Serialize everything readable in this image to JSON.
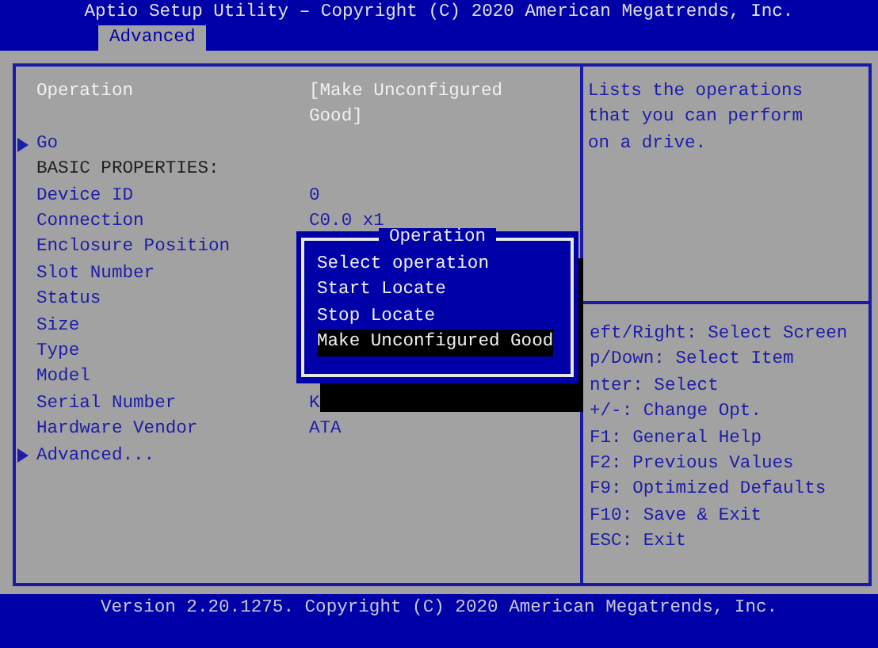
{
  "header": {
    "title": "Aptio Setup Utility – Copyright (C) 2020 American Megatrends, Inc.",
    "tabs": [
      {
        "label": "Advanced",
        "selected": true
      }
    ]
  },
  "items": [
    {
      "kind": "setting",
      "label": "Operation",
      "value": "[Make Unconfigured Good]",
      "focused": true
    },
    {
      "kind": "submenu",
      "label": "Go",
      "focused": false
    },
    {
      "kind": "header",
      "label": "BASIC PROPERTIES:"
    },
    {
      "kind": "setting",
      "label": "Device ID",
      "value": "0",
      "focused": false
    },
    {
      "kind": "setting",
      "label": "Connection",
      "value": "C0.0 x1",
      "focused": false
    },
    {
      "kind": "setting",
      "label": "Enclosure Position",
      "focused": false
    },
    {
      "kind": "setting",
      "label": "Slot Number",
      "focused": false
    },
    {
      "kind": "setting",
      "label": "Status",
      "focused": false
    },
    {
      "kind": "setting",
      "label": "Size",
      "focused": false
    },
    {
      "kind": "setting",
      "label": "Type",
      "focused": false
    },
    {
      "kind": "setting",
      "label": "Model",
      "focused": false
    },
    {
      "kind": "setting",
      "label": "Serial Number",
      "value": "K",
      "focused": false
    },
    {
      "kind": "setting",
      "label": "Hardware Vendor",
      "value": "ATA",
      "focused": false
    },
    {
      "kind": "submenu",
      "label": "Advanced...",
      "focused": false
    }
  ],
  "help": "Lists the operations that you can perform on a drive.",
  "keys": [
    "eft/Right: Select Screen",
    "p/Down: Select Item",
    "nter: Select",
    "+/-: Change Opt.",
    "F1: General Help",
    "F2: Previous Values",
    "F9: Optimized Defaults",
    "F10: Save & Exit",
    "ESC: Exit"
  ],
  "popup": {
    "title": "Operation",
    "options": [
      {
        "label": "Select operation",
        "selected": false
      },
      {
        "label": "Start Locate",
        "selected": false
      },
      {
        "label": "Stop Locate",
        "selected": false
      },
      {
        "label": "Make Unconfigured Good",
        "selected": true
      }
    ]
  },
  "footer": "Version 2.20.1275. Copyright (C) 2020 American Megatrends, Inc."
}
